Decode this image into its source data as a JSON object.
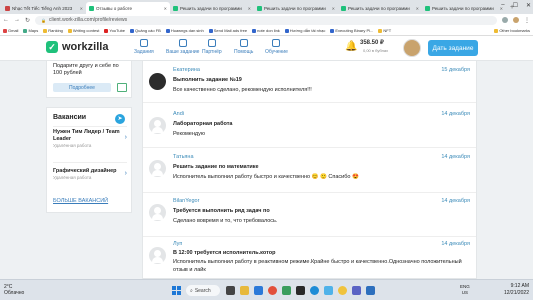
{
  "browser": {
    "tabs": [
      {
        "label": "Nhạc Tết Tiếc Tiếng Anh 2023",
        "active": false
      },
      {
        "label": "Отзывы о работе",
        "active": true
      },
      {
        "label": "Решить задачи по программи",
        "active": false
      },
      {
        "label": "Решить задачи по программи",
        "active": false
      },
      {
        "label": "Решить задачи по программи",
        "active": false
      },
      {
        "label": "Решить задачи по программи",
        "active": false
      }
    ],
    "new_tab": "+",
    "url": "client.work-zilla.com/profile/reviews",
    "bookmarks": [
      "Gmail",
      "Maps",
      "Ranking",
      "Writing contest",
      "YouTube",
      "Quảng cáo FB",
      "Huawngs dan sinh",
      "Send Mail ads free",
      "note don link",
      "Hướng dẫn tải nhạc",
      "Executing Binary Pl...",
      "NFT",
      "Other bookmarks"
    ]
  },
  "header": {
    "logo": "workzilla",
    "nav": [
      {
        "label": "Задания"
      },
      {
        "label": "Ваше задание"
      },
      {
        "label": "Партнёр"
      },
      {
        "label": "Помощь"
      },
      {
        "label": "Обучение"
      }
    ],
    "balance": "358.50 ₽",
    "bonus": "0,00 в бубнах",
    "give_task": "Дать задание"
  },
  "sidebar": {
    "promo_text": "Подарите другу и себе по 100 рублей",
    "promo_button": "Подробнее",
    "vacancies_title": "Вакансии",
    "vacancies": [
      {
        "name": "Нужен Тим Лидер / Team Leader",
        "location": "Удалённая работа"
      },
      {
        "name": "Графический дизайнер",
        "location": "Удалённая работа"
      }
    ],
    "more_vacancies": "БОЛЬШЕ ВАКАНСИЙ"
  },
  "reviews": [
    {
      "user": "Екатерина",
      "date": "15 декабря",
      "title": "Выполнить задание №19",
      "text": "Все качественно сделано, рекомендую исполнителя!!!",
      "dark_avatar": true
    },
    {
      "user": "Andi",
      "date": "14 декабря",
      "title": "Лабораторная работа",
      "text": "Рекомендую",
      "dark_avatar": false
    },
    {
      "user": "Татьяна",
      "date": "14 декабря",
      "title": "Решить задание по математике",
      "text": "Исполнитель выполнил работу быстро и качественно 😊 🙂 Спасибо 😍",
      "dark_avatar": false
    },
    {
      "user": "BilanYegor",
      "date": "14 декабря",
      "title": "Требуется выполнить ряд задач по",
      "text": "Сделано вовремя и то, что требовалось.",
      "dark_avatar": false
    },
    {
      "user": "Луп",
      "date": "14 декабря",
      "title": "В 12:00 требуется исполнитель.котор",
      "text": "Исполнитель выполнил работу в реактивном режиме.Крайне быстро и качественно.Однозначно положительный отзыв и лайк",
      "dark_avatar": false
    }
  ],
  "taskbar": {
    "weather_temp": "2°C",
    "weather_desc": "Облачно",
    "search": "Search",
    "lang": "ENG",
    "lang2": "US",
    "time": "9:12 AM",
    "date": "12/21/2022"
  }
}
